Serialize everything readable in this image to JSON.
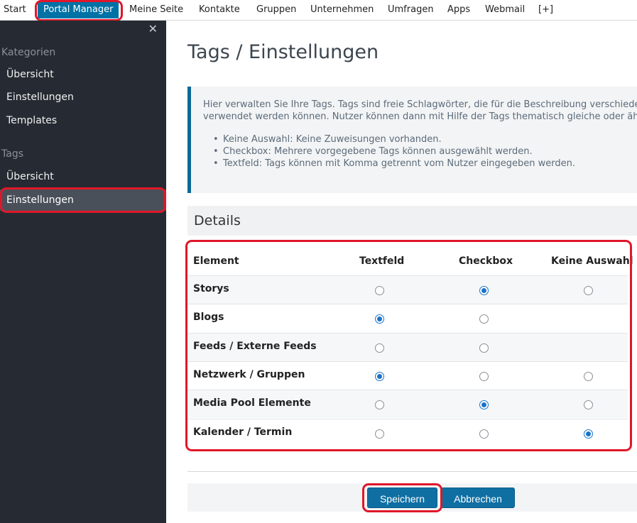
{
  "topnav": {
    "items": [
      {
        "label": "Start"
      },
      {
        "label": "Portal Manager",
        "active": true
      },
      {
        "label": "Meine Seite"
      },
      {
        "label": "Kontakte"
      },
      {
        "label": "Gruppen"
      },
      {
        "label": "Unternehmen"
      },
      {
        "label": "Umfragen"
      },
      {
        "label": "Apps"
      },
      {
        "label": "Webmail"
      },
      {
        "label": "[+]"
      }
    ]
  },
  "sidebar": {
    "close_icon": "close-icon",
    "close_glyph": "✕",
    "sections": [
      {
        "title": "Kategorien",
        "items": [
          {
            "label": "Übersicht"
          },
          {
            "label": "Einstellungen"
          },
          {
            "label": "Templates"
          }
        ]
      },
      {
        "title": "Tags",
        "items": [
          {
            "label": "Übersicht"
          },
          {
            "label": "Einstellungen",
            "active": true
          }
        ]
      }
    ]
  },
  "main": {
    "title": "Tags / Einstellungen",
    "info": {
      "line1": "Hier verwalten Sie Ihre Tags. Tags sind freie Schlagwörter, die für die Beschreibung verschiedener Elemente",
      "line2": "verwendet werden können. Nutzer können dann mit Hilfe der Tags thematisch gleiche oder ähnliche Inhalte finden.",
      "bullets": [
        "Keine Auswahl: Keine Zuweisungen vorhanden.",
        "Checkbox: Mehrere vorgegebene Tags können ausgewählt werden.",
        "Textfeld: Tags können mit Komma getrennt vom Nutzer eingegeben werden."
      ]
    },
    "details_title": "Details",
    "table": {
      "headers": [
        "Element",
        "Textfeld",
        "Checkbox",
        "Keine Auswahl"
      ],
      "rows": [
        {
          "label": "Storys",
          "options": [
            "unchecked",
            "checked",
            "unchecked"
          ]
        },
        {
          "label": "Blogs",
          "options": [
            "checked",
            "unchecked",
            "none"
          ]
        },
        {
          "label": "Feeds / Externe Feeds",
          "options": [
            "unchecked",
            "unchecked",
            "none"
          ]
        },
        {
          "label": "Netzwerk / Gruppen",
          "options": [
            "checked",
            "unchecked",
            "unchecked"
          ]
        },
        {
          "label": "Media Pool Elemente",
          "options": [
            "unchecked",
            "checked",
            "unchecked"
          ]
        },
        {
          "label": "Kalender / Termin",
          "options": [
            "unchecked",
            "unchecked",
            "checked"
          ]
        }
      ]
    },
    "buttons": {
      "save": "Speichern",
      "cancel": "Abbrechen"
    }
  },
  "colors": {
    "accent": "#0072a6",
    "highlight": "#e0172a",
    "sidebar_bg": "#262b33"
  }
}
